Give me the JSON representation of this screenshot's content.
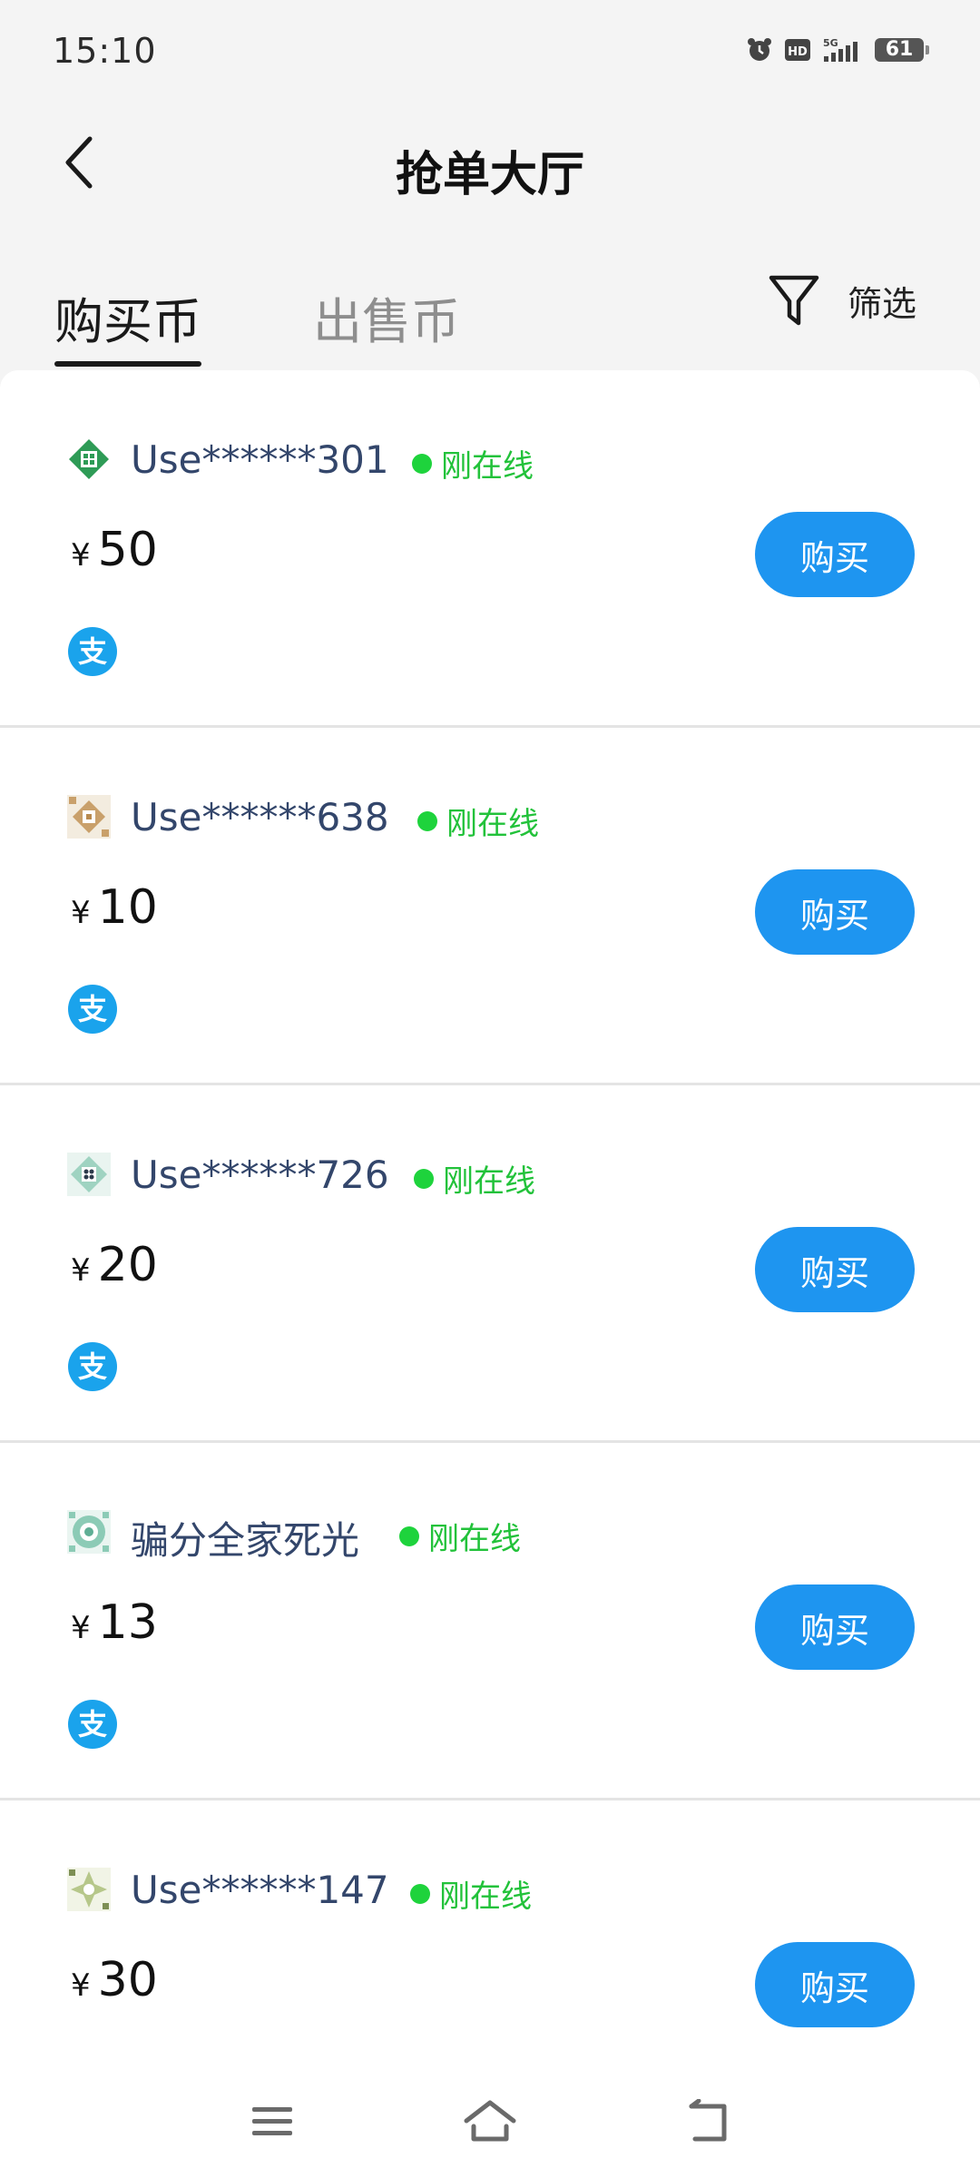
{
  "status_bar": {
    "time": "15:10",
    "icons": [
      "alarm-icon",
      "hd-icon",
      "signal-5g-icon"
    ],
    "battery": "61"
  },
  "header": {
    "title": "抢单大厅",
    "back_icon": "back-chevron-icon"
  },
  "tabs": {
    "buy_label": "购买币",
    "sell_label": "出售币",
    "active": "buy",
    "filter_label": "筛选",
    "filter_icon": "filter-funnel-icon"
  },
  "colors": {
    "accent": "#1e95f0",
    "online": "#1ed33c",
    "username": "#33466b"
  },
  "orders": [
    {
      "username": "Use******301",
      "status": "刚在线",
      "currency": "¥",
      "amount": "50",
      "payment_icon": "alipay-icon",
      "button": "购买"
    },
    {
      "username": "Use******638",
      "status": "刚在线",
      "currency": "¥",
      "amount": "10",
      "payment_icon": "alipay-icon",
      "button": "购买"
    },
    {
      "username": "Use******726",
      "status": "刚在线",
      "currency": "¥",
      "amount": "20",
      "payment_icon": "alipay-icon",
      "button": "购买"
    },
    {
      "username": "骗分全家死光",
      "status": "刚在线",
      "currency": "¥",
      "amount": "13",
      "payment_icon": "alipay-icon",
      "button": "购买"
    },
    {
      "username": "Use******147",
      "status": "刚在线",
      "currency": "¥",
      "amount": "30",
      "payment_icon": "alipay-icon",
      "button": "购买"
    }
  ],
  "nav_bar": {
    "icons": [
      "menu-icon",
      "home-icon",
      "back-icon"
    ]
  }
}
